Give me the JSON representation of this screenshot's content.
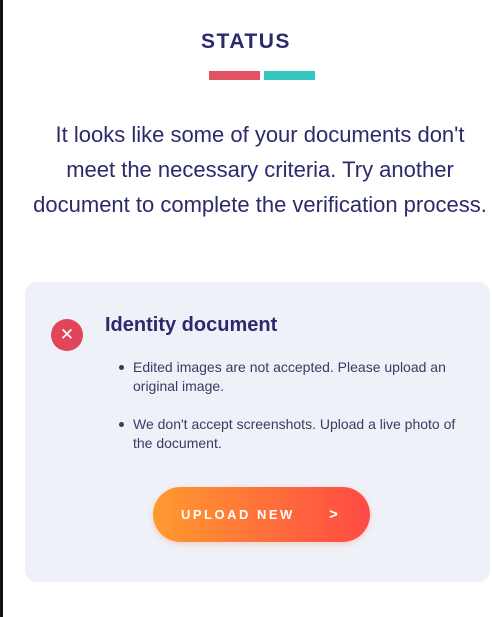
{
  "colors": {
    "title": "#2b2a6b",
    "underline_left": "#e05264",
    "underline_right": "#33c7bf",
    "card_background": "#eff1f8",
    "error_icon": "#e0455a",
    "button_gradient_start": "#ff9a2e",
    "button_gradient_end": "#ff4a45"
  },
  "header": {
    "title": "STATUS"
  },
  "message": {
    "text": "It looks like some of your documents don't meet the necessary criteria. Try another document to complete the verification process."
  },
  "document_card": {
    "icon": "close-icon",
    "icon_glyph": "✕",
    "title": "Identity document",
    "reasons": [
      "Edited images are not accepted. Please upload an original image.",
      "We don't accept screenshots. Upload a live photo of the document."
    ],
    "upload_button": {
      "label": "UPLOAD NEW",
      "arrow": ">"
    }
  }
}
